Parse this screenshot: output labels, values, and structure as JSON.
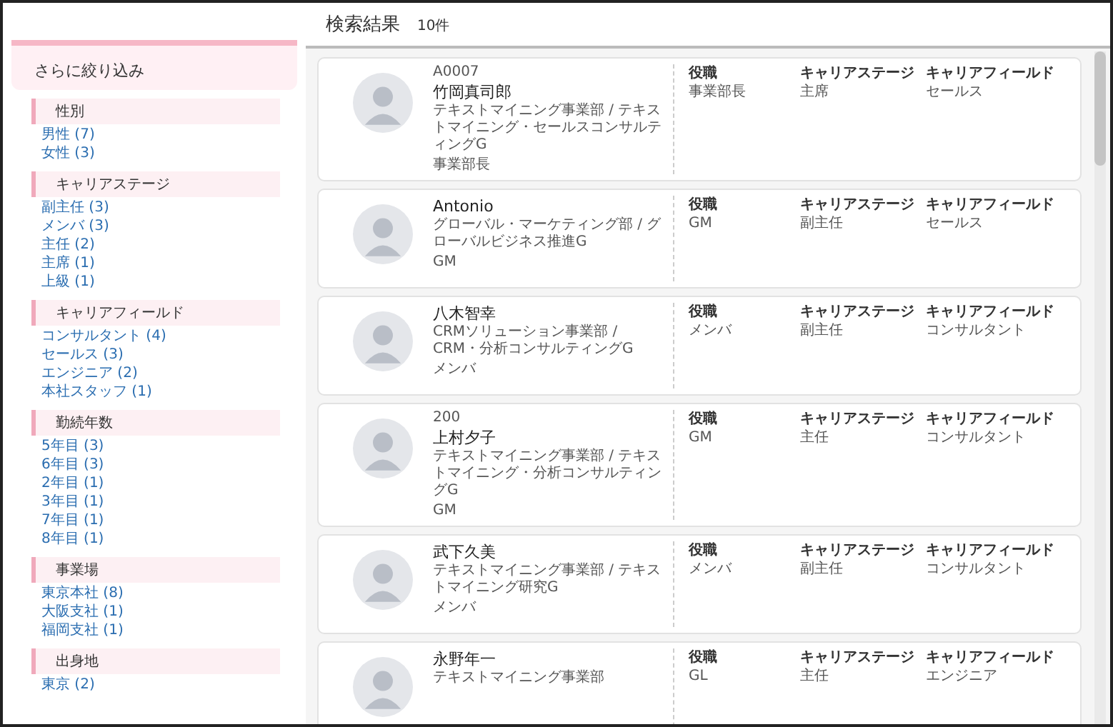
{
  "sidebar": {
    "title": "さらに絞り込み",
    "groups": [
      {
        "heading": "性別",
        "items": [
          "男性 (7)",
          "女性 (3)"
        ]
      },
      {
        "heading": "キャリアステージ",
        "items": [
          "副主任 (3)",
          "メンバ (3)",
          "主任 (2)",
          "主席 (1)",
          "上級 (1)"
        ]
      },
      {
        "heading": "キャリアフィールド",
        "items": [
          "コンサルタント (4)",
          "セールス (3)",
          "エンジニア (2)",
          "本社スタッフ (1)"
        ]
      },
      {
        "heading": "勤続年数",
        "items": [
          "5年目 (3)",
          "6年目 (3)",
          "2年目 (1)",
          "3年目 (1)",
          "7年目 (1)",
          "8年目 (1)"
        ]
      },
      {
        "heading": "事業場",
        "items": [
          "東京本社 (8)",
          "大阪支社 (1)",
          "福岡支社 (1)"
        ]
      },
      {
        "heading": "出身地",
        "items": [
          "東京 (2)"
        ]
      }
    ]
  },
  "results": {
    "title": "検索結果",
    "count": "10件",
    "people": [
      {
        "id": "A0007",
        "name": "竹岡真司郎",
        "department": "テキストマイニング事業部 / テキストマイニング・セールスコンサルティングG",
        "title": "事業部長",
        "attributes": [
          {
            "label": "役職",
            "value": "事業部長"
          },
          {
            "label": "キャリアステージ",
            "value": "主席"
          },
          {
            "label": "キャリアフィールド",
            "value": "セールス"
          }
        ]
      },
      {
        "name": "Antonio",
        "department": "グローバル・マーケティング部 / グローバルビジネス推進G",
        "title": "GM",
        "attributes": [
          {
            "label": "役職",
            "value": "GM"
          },
          {
            "label": "キャリアステージ",
            "value": "副主任"
          },
          {
            "label": "キャリアフィールド",
            "value": "セールス"
          }
        ]
      },
      {
        "name": "八木智幸",
        "department": "CRMソリューション事業部 / CRM・分析コンサルティングG",
        "title": "メンバ",
        "attributes": [
          {
            "label": "役職",
            "value": "メンバ"
          },
          {
            "label": "キャリアステージ",
            "value": "副主任"
          },
          {
            "label": "キャリアフィールド",
            "value": "コンサルタント"
          }
        ]
      },
      {
        "id": "200",
        "name": "上村夕子",
        "department": "テキストマイニング事業部 / テキストマイニング・分析コンサルティングG",
        "title": "GM",
        "attributes": [
          {
            "label": "役職",
            "value": "GM"
          },
          {
            "label": "キャリアステージ",
            "value": "主任"
          },
          {
            "label": "キャリアフィールド",
            "value": "コンサルタント"
          }
        ]
      },
      {
        "name": "武下久美",
        "department": "テキストマイニング事業部 / テキストマイニング研究G",
        "title": "メンバ",
        "attributes": [
          {
            "label": "役職",
            "value": "メンバ"
          },
          {
            "label": "キャリアステージ",
            "value": "副主任"
          },
          {
            "label": "キャリアフィールド",
            "value": "コンサルタント"
          }
        ]
      },
      {
        "name": "永野年一",
        "department": "テキストマイニング事業部",
        "attributes": [
          {
            "label": "役職",
            "value": "GL"
          },
          {
            "label": "キャリアステージ",
            "value": "主任"
          },
          {
            "label": "キャリアフィールド",
            "value": "エンジニア"
          }
        ]
      }
    ]
  }
}
